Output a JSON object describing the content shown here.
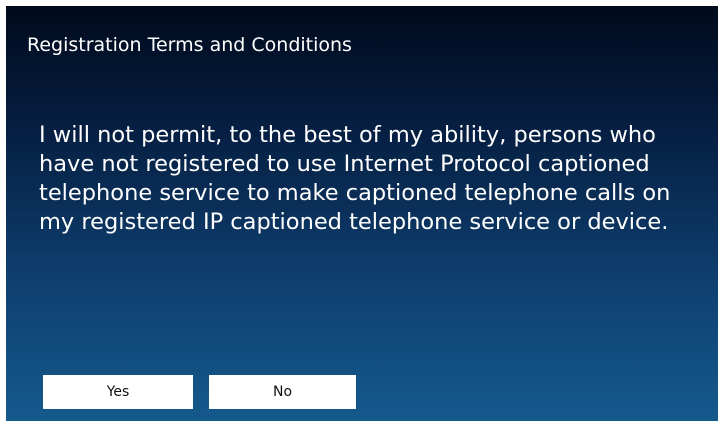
{
  "dialog": {
    "title": "Registration Terms and Conditions",
    "message": "I will not permit, to the best of my ability, persons who have not registered to use Internet Protocol captioned telephone service to make captioned telephone calls on my registered IP captioned telephone service or device.",
    "yes_label": "Yes",
    "no_label": "No"
  },
  "colors": {
    "background_top": "#000a1c",
    "background_bottom": "#155a8d",
    "text": "#ffffff",
    "button_bg": "#ffffff"
  }
}
